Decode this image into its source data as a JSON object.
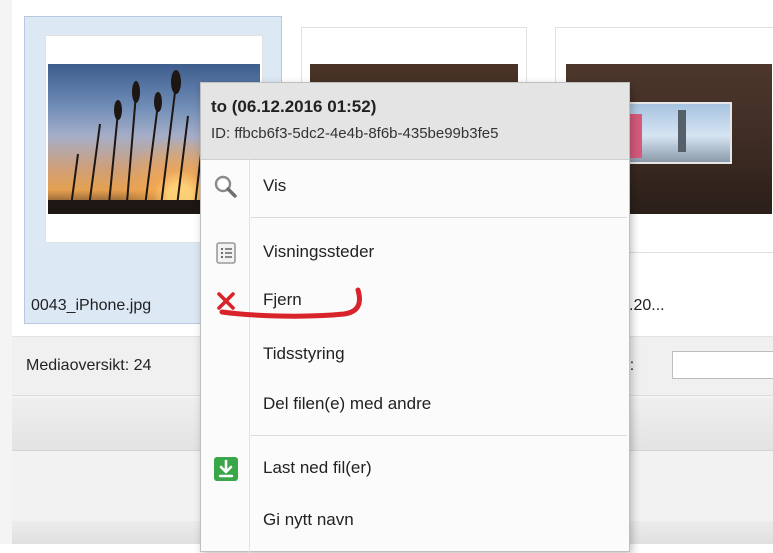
{
  "gallery": {
    "tiles": [
      {
        "caption": "0043_iPhone.jpg",
        "selected": true
      },
      {
        "caption": "",
        "selected": false
      },
      {
        "caption": ".20...",
        "selected": false
      }
    ]
  },
  "toolbar": {
    "overview_text": "Mediaoversikt: 24",
    "search_label": "øk:",
    "search_value": ""
  },
  "context_menu": {
    "title": "to (06.12.2016 01:52)",
    "id_line": "ID: ffbcb6f3-5dc2-4e4b-8f6b-435be99b3fe5",
    "items": [
      {
        "label": "Vis",
        "icon": "magnifier-icon"
      },
      {
        "label": "Visningssteder",
        "icon": "list-icon"
      },
      {
        "label": "Fjern",
        "icon": "red-x-icon"
      },
      {
        "label": "Tidsstyring",
        "icon": ""
      },
      {
        "label": "Del filen(e) med andre",
        "icon": ""
      },
      {
        "label": "Last ned fil(er)",
        "icon": "download-icon"
      },
      {
        "label": "Gi nytt navn",
        "icon": ""
      }
    ]
  },
  "colors": {
    "accent_red": "#d9232a",
    "download_green": "#3aa64a",
    "selected_tile": "#dde8f5"
  }
}
